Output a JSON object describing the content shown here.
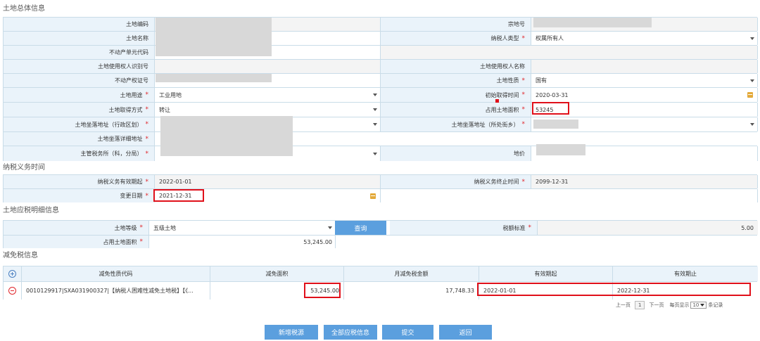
{
  "sections": {
    "overall": "土地总体信息",
    "tax_period": "纳税义务时间",
    "detail": "土地应税明细信息",
    "relief": "减免税信息"
  },
  "overall": {
    "land_code_label": "土地编码",
    "parcel_no_label": "宗地号",
    "land_name_label": "土地名称",
    "taxpayer_type_label": "纳税人类型",
    "taxpayer_type_value": "权属所有人",
    "property_unit_label": "不动产单元代码",
    "user_id_label": "土地使用权人识别号",
    "user_name_label": "土地使用权人名称",
    "cert_label": "不动产权证号",
    "nature_label": "土地性质",
    "nature_value": "国有",
    "use_label": "土地用途",
    "use_value": "工业用地",
    "acq_time_label": "初始取得时间",
    "acq_time_value": "2020-03-31",
    "acq_method_label": "土地取得方式",
    "acq_method_value": "转让",
    "area_label": "占用土地面积",
    "area_value": "53245",
    "addr_district_label": "土地坐落地址（行政区划）",
    "addr_street_label": "土地坐落地址（所处街乡）",
    "addr_detail_label": "土地坐落详细地址",
    "office_label": "主管税务所（科，分局）",
    "price_label": "地价"
  },
  "tax_period": {
    "start_label": "纳税义务有效期起",
    "start_value": "2022-01-01",
    "end_label": "纳税义务终止时间",
    "end_value": "2099-12-31",
    "change_label": "变更日期",
    "change_value": "2021-12-31"
  },
  "detail": {
    "grade_label": "土地等级",
    "grade_value": "五级土地",
    "query_button": "查询",
    "tax_std_label": "税额标准",
    "tax_std_value": "5.00",
    "area_label": "占用土地面积",
    "area_value": "53,245.00"
  },
  "relief": {
    "columns": [
      "减免性质代码",
      "减免面积",
      "月减免税金额",
      "有效期起",
      "有效期止"
    ],
    "row": {
      "code": "0010129917|SXA031900327|【纳税人困难性减免土地税】【《...",
      "area": "53,245.00",
      "monthly": "17,748.33",
      "start": "2022-01-01",
      "end": "2022-12-31"
    },
    "pager": {
      "prev": "上一页",
      "page": "1",
      "next": "下一页",
      "per_page_label": "每页显示",
      "per_page_value": "10",
      "unit": "条记录"
    }
  },
  "buttons": {
    "add_source": "新增税源",
    "all_tax_info": "全部应税信息",
    "submit": "提交",
    "back": "返回"
  },
  "colors": {
    "accent": "#5b9fde",
    "label_bg": "#eaf3fa",
    "required": "#e0262b",
    "highlight": "#e0101a"
  }
}
